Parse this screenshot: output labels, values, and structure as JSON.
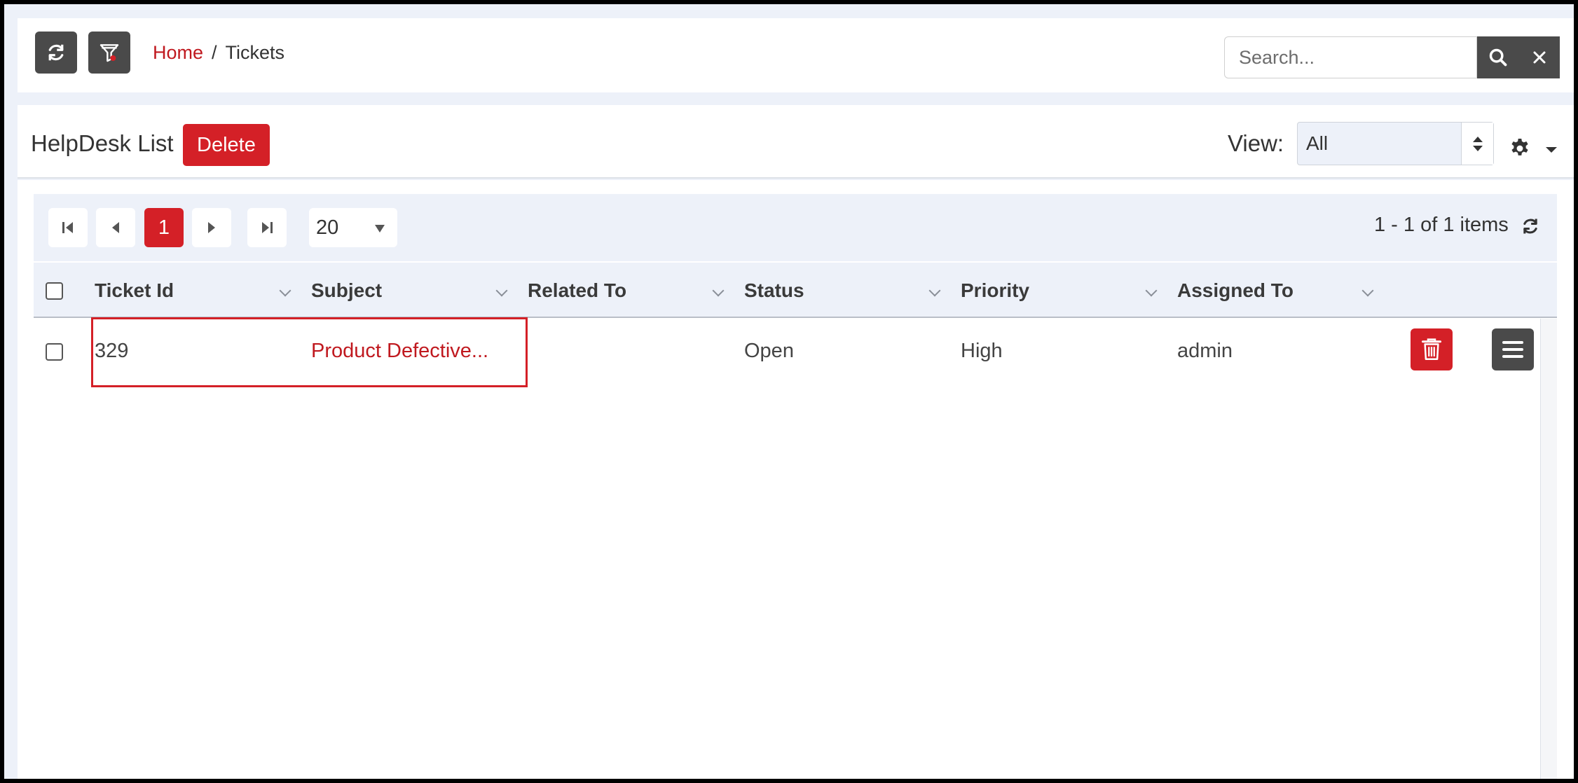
{
  "colors": {
    "accent": "#d42027",
    "dark_button": "#4a4a4a",
    "panel_bg": "#edf1f9"
  },
  "toolbar": {
    "refresh_icon": "refresh-icon",
    "filter_icon": "filter-icon"
  },
  "breadcrumb": {
    "home": "Home",
    "separator": "/",
    "current": "Tickets"
  },
  "search": {
    "placeholder": "Search...",
    "value": ""
  },
  "list": {
    "title": "HelpDesk List",
    "delete_label": "Delete"
  },
  "view": {
    "label": "View:",
    "selected": "All"
  },
  "pager": {
    "current_page": "1",
    "page_size": "20",
    "info": "1 - 1 of 1 items"
  },
  "columns": [
    "Ticket Id",
    "Subject",
    "Related To",
    "Status",
    "Priority",
    "Assigned To"
  ],
  "rows": [
    {
      "ticket_id": "329",
      "subject": "Product Defective...",
      "related_to": "",
      "status": "Open",
      "priority": "High",
      "assigned_to": "admin"
    }
  ]
}
